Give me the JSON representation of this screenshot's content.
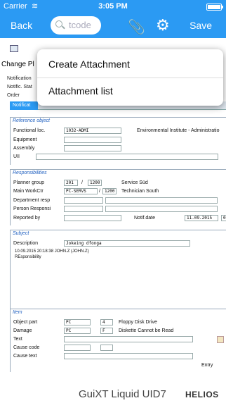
{
  "status": {
    "carrier": "Carrier",
    "time": "3:05 PM"
  },
  "nav": {
    "back": "Back",
    "search_placeholder": "tcode",
    "save": "Save"
  },
  "popup": {
    "items": [
      "Create Attachment",
      "Attachment list"
    ]
  },
  "header": {
    "title": "Change Pl",
    "rows": [
      "Notification",
      "Notific. Stat",
      "Order"
    ],
    "tab": "Notificat"
  },
  "reference": {
    "title": "Reference object",
    "functional_loc_label": "Functional loc.",
    "functional_loc_value": "1032-ADMI",
    "functional_loc_desc": "Environmental Institute - Administratio",
    "equipment_label": "Equipment",
    "assembly_label": "Assembly",
    "uii_label": "UII"
  },
  "responsibilities": {
    "title": "Responsibilities",
    "planner_group_label": "Planner group",
    "planner_group_value": "201",
    "planner_group_sep": "/",
    "planner_group_plant": "1200",
    "planner_group_desc": "Service Süd",
    "main_workctr_label": "Main WorkCtr",
    "main_workctr_value": "PC-SERVS",
    "main_workctr_sep": "/",
    "main_workctr_plant": "1200",
    "main_workctr_desc": "Technician South",
    "dept_resp_label": "Department resp",
    "person_resp_label": "Person Responsi",
    "reported_by_label": "Reported by",
    "notif_date_label": "Notif.date",
    "notif_date_value": "11.09.2015",
    "notif_time_value": "0"
  },
  "subject": {
    "title": "Subject",
    "description_label": "Description",
    "description_value": "Jokeing dfonga",
    "log_line1": "10.09.2015 20:18:38  JOHN.Z (JOHN.Z)",
    "log_line2": "REsponsibility"
  },
  "item": {
    "title": "Item",
    "object_part_label": "Object part",
    "object_part_code": "PC",
    "object_part_num": "4",
    "object_part_desc": "Floppy Disk Drive",
    "damage_label": "Damage",
    "damage_code": "PC",
    "damage_num": "F",
    "damage_desc": "Diskette Cannot be Read",
    "text_label": "Text",
    "cause_code_label": "Cause code",
    "cause_text_label": "Cause text",
    "entry_label": "Entry"
  },
  "footer": {
    "brand": "GuiXT Liquid UID7",
    "helios": "HELIOS"
  }
}
